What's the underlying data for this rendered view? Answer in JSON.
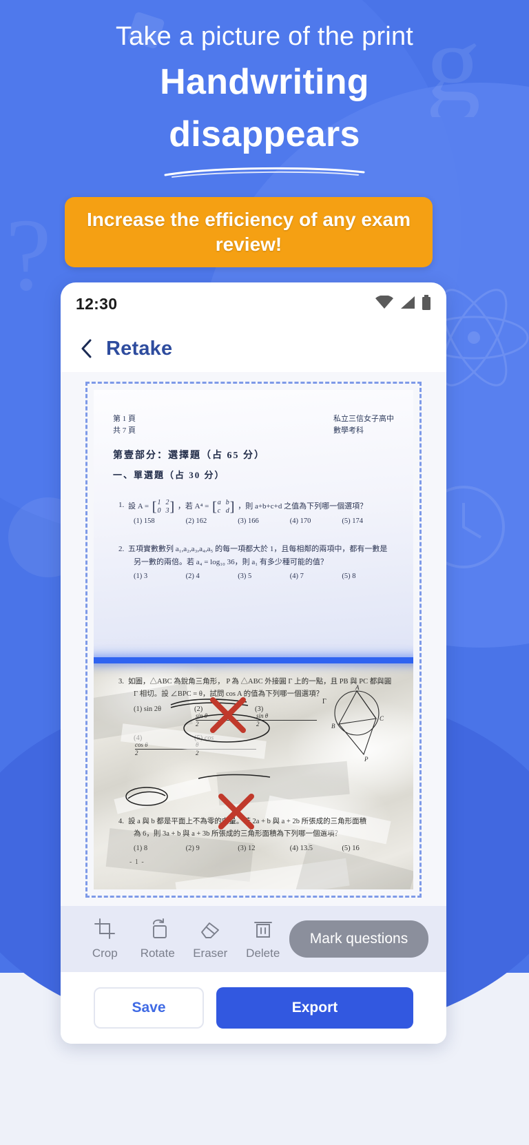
{
  "promo": {
    "line1": "Take a picture of the print",
    "line2": "Handwriting",
    "line3": "disappears",
    "badge": "Increase the efficiency of any exam review!",
    "colors": {
      "background": "#4a74e8",
      "badge": "#f5a013",
      "accent": "#3258e0"
    }
  },
  "phone": {
    "status": {
      "time": "12:30",
      "wifi_icon": "wifi-icon",
      "signal_icon": "signal-icon",
      "battery_icon": "battery-icon"
    },
    "appbar": {
      "back_icon": "back-chevron-icon",
      "title": "Retake"
    }
  },
  "document": {
    "header_left": "第 1 頁\n共 7 頁",
    "header_right": "私立三信女子高中\n數學考科",
    "section_title": "第壹部分：選擇題（占 65 分）",
    "subsection_title": "一、單選題（占 30 分）",
    "questions": [
      {
        "num": "1.",
        "text_before": "設 A =",
        "matrix_a": [
          "1",
          "2",
          "0",
          "3"
        ],
        "text_mid": "，若 A⁴ =",
        "matrix_b": [
          "a",
          "b",
          "c",
          "d"
        ],
        "text_after": "，則 a+b+c+d 之值為下列哪一個選項？",
        "options": [
          "(1) 158",
          "(2) 162",
          "(3) 166",
          "(4) 170",
          "(5) 174"
        ]
      },
      {
        "num": "2.",
        "line1": "五項實數數列 a₁,a₂,a₃,a₄,a₅ 的每一項都大於 1，且每相鄰的兩項中，都有一數是",
        "line2": "另一數的兩倍。若 a₄ = log₁₀ 36，則 a₁ 有多少種可能的值？",
        "options": [
          "(1) 3",
          "(2) 4",
          "(3) 5",
          "(4) 7",
          "(5) 8"
        ]
      },
      {
        "num": "3.",
        "line1": "如圖，△ABC 為銳角三角形， P 為 △ABC 外接圓 Γ 上的一點，且 PB 與 PC 都與圓",
        "line2": "Γ 相切。設 ∠BPC = θ，試問 cos A 的值為下列哪一個選項？",
        "options_row1": [
          "(1)  sin 2θ",
          "(2)",
          "(3)"
        ],
        "options_row2": [
          "(4)",
          "(5)"
        ],
        "frac_sin": {
          "n": "sin θ",
          "d": "2"
        },
        "frac_sin2": {
          "n": "sin θ",
          "d": "2"
        },
        "frac_cos": {
          "n": "cos θ",
          "d": "2"
        },
        "cos_half": {
          "n": "θ",
          "d": "2"
        },
        "figure_labels": [
          "Γ",
          "A",
          "B",
          "C",
          "P"
        ]
      },
      {
        "num": "4.",
        "line1": "設 a 與 b 都是平面上不為零的向量。若 2a + b 與 a + 2b 所張成的三角形面積",
        "line2": "為 6，則 3a + b 與 a + 3b 所張成的三角形面積為下列哪一個選項？",
        "options": [
          "(1) 8",
          "(2) 9",
          "(3) 12",
          "(4) 13.5",
          "(5) 16"
        ]
      }
    ],
    "page_number": "- 1 -"
  },
  "toolbar": {
    "items": [
      {
        "icon": "crop-icon",
        "label": "Crop"
      },
      {
        "icon": "rotate-icon",
        "label": "Rotate"
      },
      {
        "icon": "eraser-icon",
        "label": "Eraser"
      },
      {
        "icon": "delete-icon",
        "label": "Delete"
      }
    ],
    "mark_button": "Mark questions"
  },
  "footer": {
    "save": "Save",
    "export": "Export"
  }
}
